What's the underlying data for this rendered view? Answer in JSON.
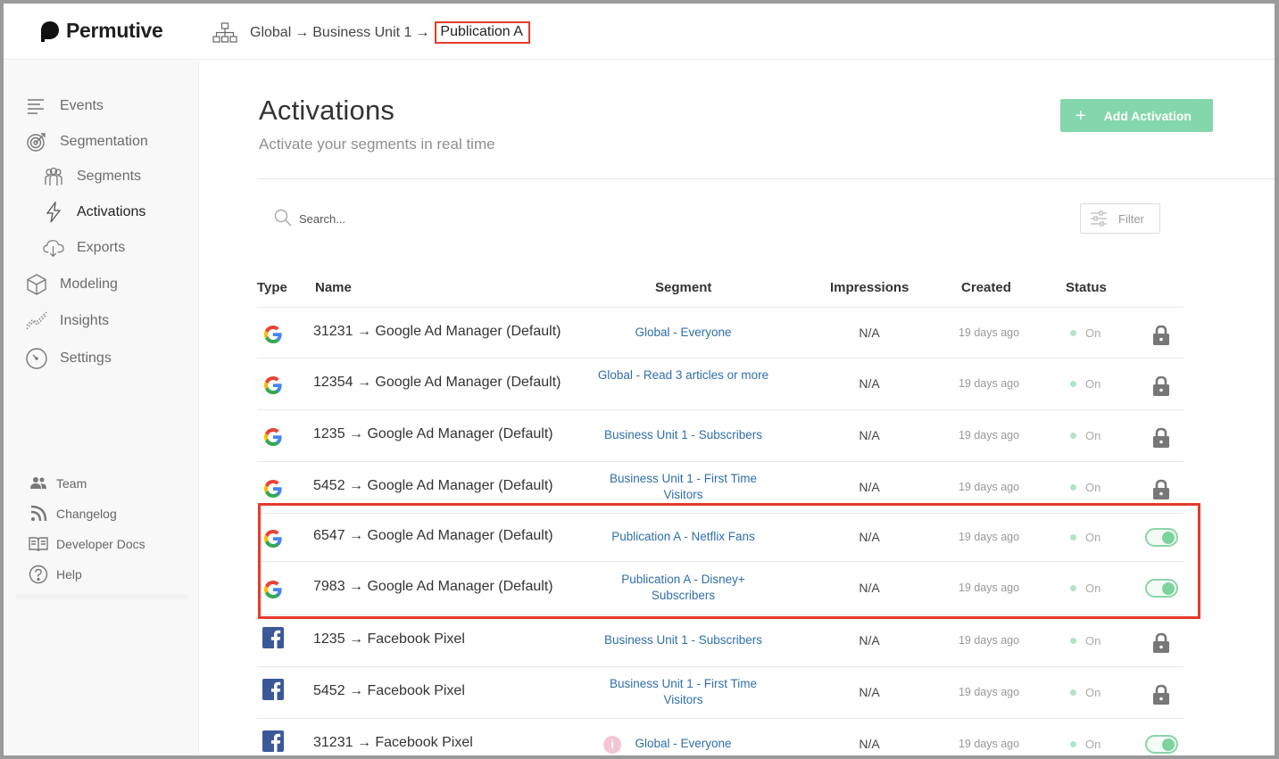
{
  "app": {
    "name": "Permutive"
  },
  "breadcrumb": {
    "items": [
      "Global",
      "Business Unit 1",
      "Publication A"
    ],
    "separator": "→"
  },
  "sidebar": {
    "items": [
      {
        "label": "Events",
        "icon": "events-icon"
      },
      {
        "label": "Segmentation",
        "icon": "target-icon"
      },
      {
        "label": "Segments",
        "icon": "people-icon"
      },
      {
        "label": "Activations",
        "icon": "lightning-icon",
        "active": true
      },
      {
        "label": "Exports",
        "icon": "cloud-download-icon"
      },
      {
        "label": "Modeling",
        "icon": "cube-icon"
      },
      {
        "label": "Insights",
        "icon": "chart-icon"
      },
      {
        "label": "Settings",
        "icon": "gauge-icon"
      }
    ],
    "footer": [
      {
        "label": "Team",
        "icon": "team-icon"
      },
      {
        "label": "Changelog",
        "icon": "rss-icon"
      },
      {
        "label": "Developer Docs",
        "icon": "book-icon"
      },
      {
        "label": "Help",
        "icon": "help-icon"
      }
    ]
  },
  "page": {
    "title": "Activations",
    "subtitle": "Activate your segments in real time",
    "add_button": "Add Activation",
    "add_button_plus": "+"
  },
  "search": {
    "placeholder": "Search..."
  },
  "filter": {
    "label": "Filter"
  },
  "table": {
    "headers": {
      "type": "Type",
      "name": "Name",
      "segment": "Segment",
      "impressions": "Impressions",
      "created": "Created",
      "status": "Status"
    },
    "rows": [
      {
        "type": "google",
        "name": "31231 → Google Ad Manager (Default)",
        "segment": "Global - Everyone",
        "impressions": "N/A",
        "created": "19 days ago",
        "status": "On",
        "control": "lock"
      },
      {
        "type": "google",
        "name": "12354 → Google Ad Manager (Default)",
        "segment": "Global - Read 3 articles or more",
        "impressions": "N/A",
        "created": "19 days ago",
        "status": "On",
        "control": "lock"
      },
      {
        "type": "google",
        "name": "1235 → Google Ad Manager (Default)",
        "segment": "Business Unit 1 - Subscribers",
        "impressions": "N/A",
        "created": "19 days ago",
        "status": "On",
        "control": "lock"
      },
      {
        "type": "google",
        "name": "5452 → Google Ad Manager (Default)",
        "segment": "Business Unit 1 - First Time Visitors",
        "impressions": "N/A",
        "created": "19 days ago",
        "status": "On",
        "control": "lock"
      },
      {
        "type": "google",
        "name": "6547 → Google Ad Manager (Default)",
        "segment": "Publication A - Netflix Fans",
        "impressions": "N/A",
        "created": "19 days ago",
        "status": "On",
        "control": "toggle"
      },
      {
        "type": "google",
        "name": "7983 → Google Ad Manager (Default)",
        "segment": "Publication A - Disney+ Subscribers",
        "impressions": "N/A",
        "created": "19 days ago",
        "status": "On",
        "control": "toggle"
      },
      {
        "type": "facebook",
        "name": "1235 → Facebook Pixel",
        "segment": "Business Unit 1 - Subscribers",
        "impressions": "N/A",
        "created": "19 days ago",
        "status": "On",
        "control": "lock"
      },
      {
        "type": "facebook",
        "name": "5452 → Facebook Pixel",
        "segment": "Business Unit 1 - First Time Visitors",
        "impressions": "N/A",
        "created": "19 days ago",
        "status": "On",
        "control": "lock"
      },
      {
        "type": "facebook",
        "name": "31231 → Facebook Pixel",
        "segment": "Global - Everyone",
        "impressions": "N/A",
        "created": "19 days ago",
        "status": "On",
        "control": "toggle",
        "info": "i"
      }
    ]
  },
  "colors": {
    "accent_green": "#84d7ab",
    "link_blue": "#2f6fa9",
    "highlight_red": "#e53b2c",
    "facebook_blue": "#3b5998"
  }
}
